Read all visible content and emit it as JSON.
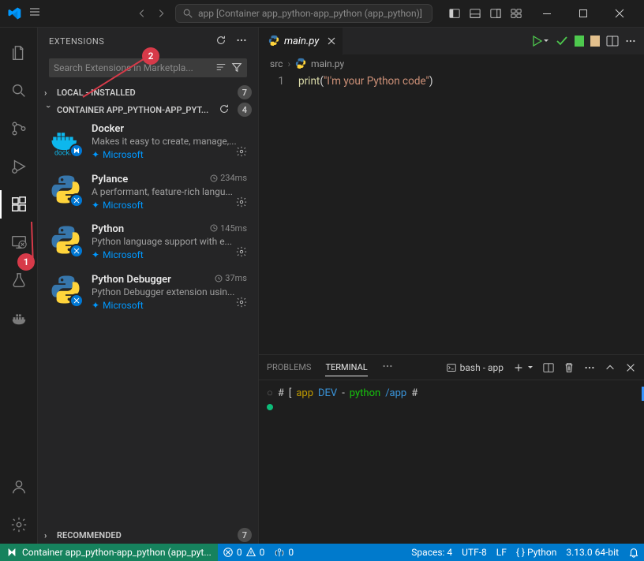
{
  "titlebar": {
    "search_text": "app [Container app_python-app_python (app_python)]"
  },
  "sidebar": {
    "title": "EXTENSIONS",
    "search_placeholder": "Search Extensions in Marketpla...",
    "sections": {
      "local": {
        "label": "LOCAL - INSTALLED",
        "badge": "7"
      },
      "container": {
        "label": "CONTAINER APP_PYTHON-APP_PYT...",
        "badge": "4"
      },
      "recommended": {
        "label": "RECOMMENDED",
        "badge": "7"
      }
    },
    "extensions": [
      {
        "name": "Docker",
        "desc": "Makes it easy to create, manage,...",
        "publisher": "Microsoft",
        "time": ""
      },
      {
        "name": "Pylance",
        "desc": "A performant, feature-rich langu...",
        "publisher": "Microsoft",
        "time": "234ms"
      },
      {
        "name": "Python",
        "desc": "Python language support with e...",
        "publisher": "Microsoft",
        "time": "145ms"
      },
      {
        "name": "Python Debugger",
        "desc": "Python Debugger extension usin...",
        "publisher": "Microsoft",
        "time": "37ms"
      }
    ]
  },
  "editor": {
    "tab_name": "main.py",
    "breadcrumb": {
      "folder": "src",
      "file": "main.py"
    },
    "line_number": "1",
    "code": {
      "fn": "print",
      "str": "\"I'm your Python code\""
    }
  },
  "panel": {
    "tabs": {
      "problems": "PROBLEMS",
      "terminal": "TERMINAL"
    },
    "terminal_label": "bash - app",
    "prompt": {
      "hash1": "#",
      "app": "app",
      "dev": "DEV",
      "dash": "-",
      "python": "python",
      "path": "/app",
      "hash2": "#"
    }
  },
  "statusbar": {
    "remote": "Container app_python-app_python (app_pyt...",
    "errors": "0",
    "warnings": "0",
    "ports": "0",
    "spaces": "Spaces: 4",
    "encoding": "UTF-8",
    "eol": "LF",
    "lang": "{ } Python",
    "version": "3.13.0 64-bit"
  },
  "callouts": {
    "one": "1",
    "two": "2"
  }
}
